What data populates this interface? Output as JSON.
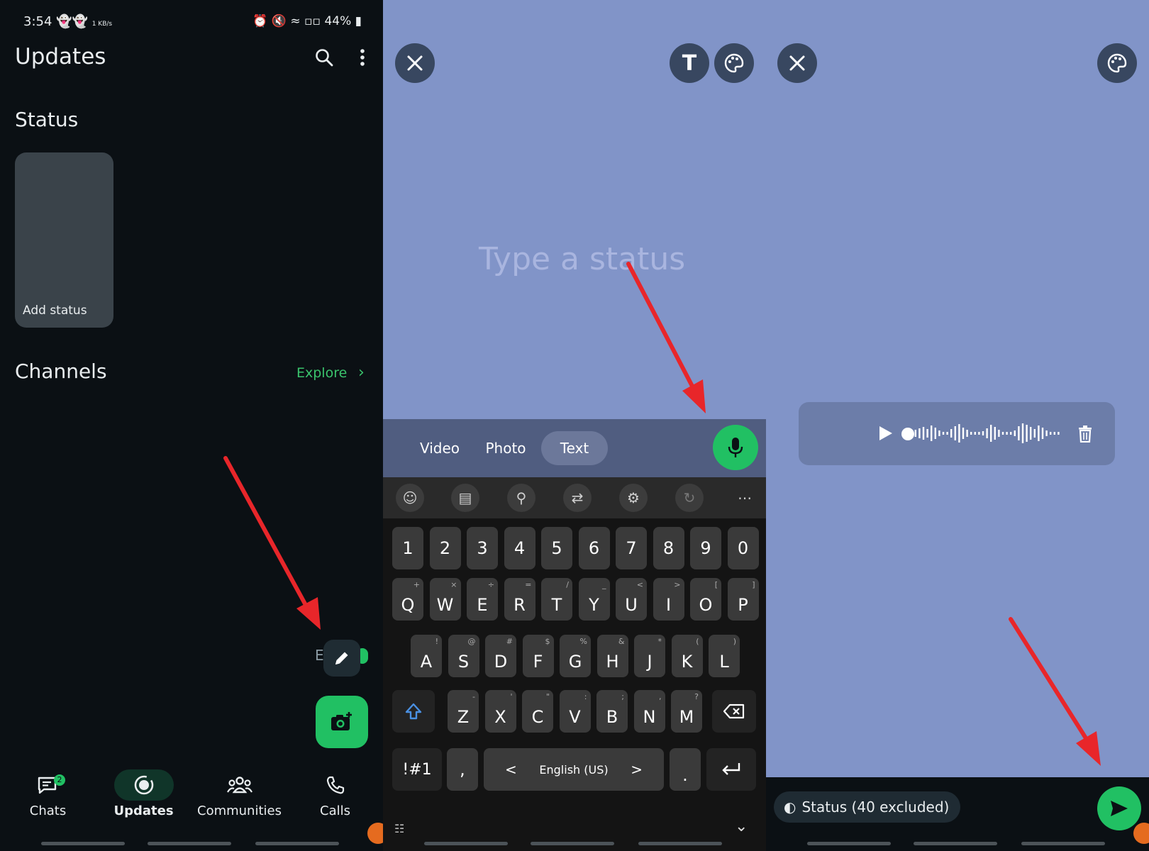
{
  "screen1": {
    "status_bar": {
      "time": "3:54",
      "speed": "1 KB/s",
      "battery": "44%"
    },
    "title": "Updates",
    "status_heading": "Status",
    "add_status_label": "Add status",
    "channels_heading": "Channels",
    "explore_label": "Explore",
    "nav": [
      {
        "label": "Chats",
        "icon": "chat-icon",
        "badge": "2"
      },
      {
        "label": "Updates",
        "icon": "updates-icon"
      },
      {
        "label": "Communities",
        "icon": "communities-icon"
      },
      {
        "label": "Calls",
        "icon": "phone-icon"
      }
    ]
  },
  "screen2": {
    "placeholder": "Type a status",
    "text_tool_label": "T",
    "modes": [
      "Video",
      "Photo",
      "Text"
    ],
    "active_mode": "Text",
    "keyboard": {
      "numbers": [
        "1",
        "2",
        "3",
        "4",
        "5",
        "6",
        "7",
        "8",
        "9",
        "0"
      ],
      "row1": [
        {
          "k": "Q",
          "s": "+"
        },
        {
          "k": "W",
          "s": "×"
        },
        {
          "k": "E",
          "s": "÷"
        },
        {
          "k": "R",
          "s": "="
        },
        {
          "k": "T",
          "s": "/"
        },
        {
          "k": "Y",
          "s": "_"
        },
        {
          "k": "U",
          "s": "<"
        },
        {
          "k": "I",
          "s": ">"
        },
        {
          "k": "O",
          "s": "["
        },
        {
          "k": "P",
          "s": "]"
        }
      ],
      "row2": [
        {
          "k": "A",
          "s": "!"
        },
        {
          "k": "S",
          "s": "@"
        },
        {
          "k": "D",
          "s": "#"
        },
        {
          "k": "F",
          "s": "$"
        },
        {
          "k": "G",
          "s": "%"
        },
        {
          "k": "H",
          "s": "&"
        },
        {
          "k": "J",
          "s": "*"
        },
        {
          "k": "K",
          "s": "("
        },
        {
          "k": "L",
          "s": ")"
        }
      ],
      "row3": [
        {
          "k": "Z",
          "s": "-"
        },
        {
          "k": "X",
          "s": "'"
        },
        {
          "k": "C",
          "s": "\""
        },
        {
          "k": "V",
          "s": ":"
        },
        {
          "k": "B",
          "s": ";"
        },
        {
          "k": "N",
          "s": ","
        },
        {
          "k": "M",
          "s": "?"
        }
      ],
      "symbols_key": "!#1",
      "comma_key": ",",
      "period_key": ".",
      "space_label": "English (US)",
      "space_prev": "<",
      "space_next": ">"
    }
  },
  "screen3": {
    "audience_label": "Status (40 excluded)"
  },
  "colors": {
    "accent": "#21c063",
    "status_bg": "#8194c8",
    "arrow": "#e8262a"
  }
}
